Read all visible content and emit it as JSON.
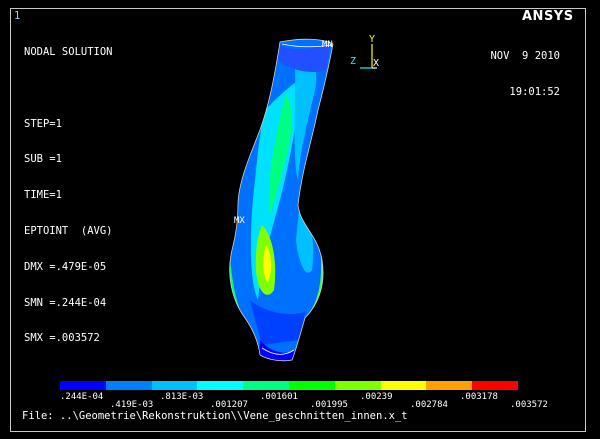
{
  "window_number": "1",
  "logo": "ANSYS",
  "info_lines": [
    "NODAL SOLUTION",
    "",
    "STEP=1",
    "SUB =1",
    "TIME=1",
    "EPTOINT  (AVG)",
    "DMX =.479E-05",
    "SMN =.244E-04",
    "SMX =.003572"
  ],
  "date": "NOV  9 2010",
  "time": "19:01:52",
  "markers": {
    "mn": "MN",
    "mx": "MX"
  },
  "triad": {
    "y": "Y",
    "z": "Z",
    "x": "X"
  },
  "legend": {
    "colors": [
      "#0000ff",
      "#0080ff",
      "#00c0ff",
      "#00ffff",
      "#00ff80",
      "#00ff00",
      "#80ff00",
      "#ffff00",
      "#ffa000",
      "#ff0000"
    ],
    "labels_bottom": [
      ".244E-04",
      ".813E-03",
      ".001601",
      ".00239",
      ".003178"
    ],
    "labels_top": [
      ".419E-03",
      ".001207",
      ".001995",
      ".002784",
      ".003572"
    ]
  },
  "file_line": "File: ..\\Geometrie\\Rekonstruktion\\\\Vene_geschnitten_innen.x_t"
}
